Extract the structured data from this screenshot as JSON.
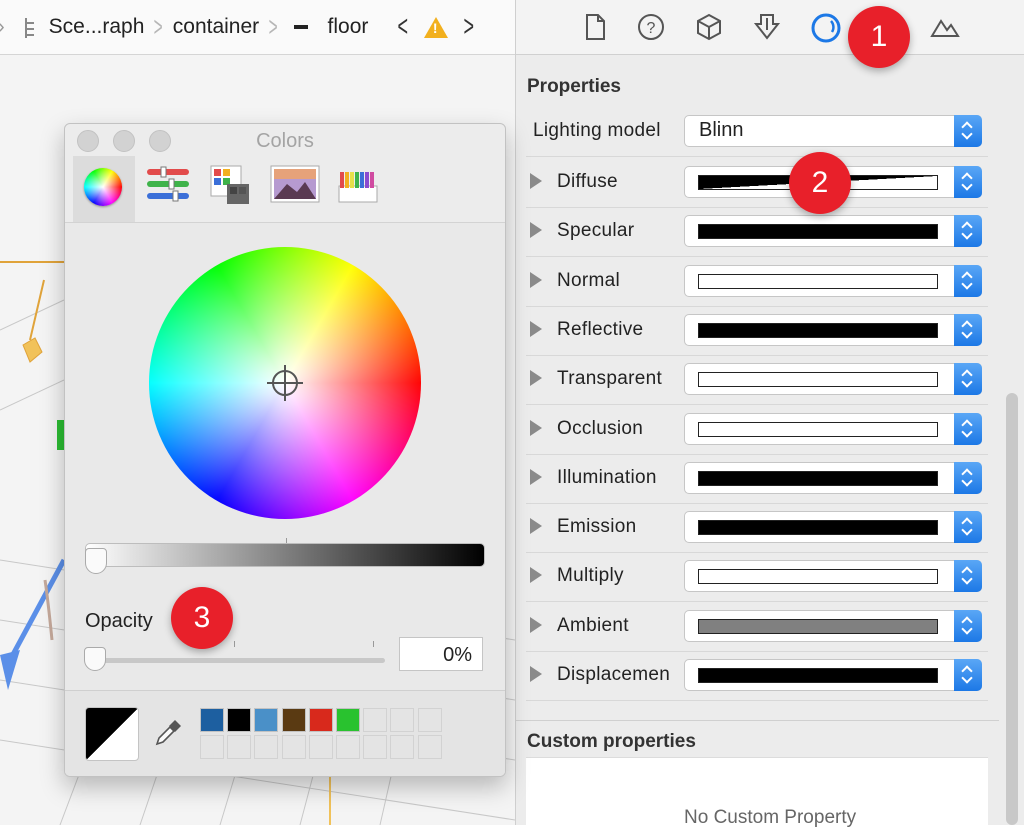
{
  "breadcrumb": {
    "items": [
      "Sce...raph",
      "container",
      "floor"
    ]
  },
  "inspector": {
    "tabs": [
      "file-inspector",
      "quick-help",
      "node-inspector",
      "attributes-inspector",
      "material-inspector",
      "scene-inspector"
    ],
    "properties_title": "Properties",
    "lighting_model_label": "Lighting model",
    "lighting_model_value": "Blinn",
    "properties": [
      {
        "label": "Diffuse",
        "swatch": "#000000",
        "white_swatch": false
      },
      {
        "label": "Specular",
        "swatch": "#000000",
        "white_swatch": false
      },
      {
        "label": "Normal",
        "swatch": "#ffffff",
        "white_swatch": true
      },
      {
        "label": "Reflective",
        "swatch": "#000000",
        "white_swatch": false
      },
      {
        "label": "Transparent",
        "swatch": "#ffffff",
        "white_swatch": true
      },
      {
        "label": "Occlusion",
        "swatch": "#ffffff",
        "white_swatch": true
      },
      {
        "label": "Illumination",
        "swatch": "#000000",
        "white_swatch": false
      },
      {
        "label": "Emission",
        "swatch": "#000000",
        "white_swatch": false
      },
      {
        "label": "Multiply",
        "swatch": "#ffffff",
        "white_swatch": true
      },
      {
        "label": "Ambient",
        "swatch": "#808080",
        "white_swatch": false
      },
      {
        "label": "Displacemen",
        "swatch": "#000000",
        "white_swatch": false
      }
    ],
    "custom_title": "Custom properties",
    "no_custom": "No Custom Property"
  },
  "colors_panel": {
    "title": "Colors",
    "modes": [
      "color-wheel",
      "color-sliders",
      "color-palettes",
      "image-palettes",
      "pencils"
    ],
    "opacity_label": "Opacity",
    "opacity_value": "0%",
    "opacity_fraction": 0,
    "brightness_fraction": 0,
    "swatches": [
      "#1d5fa0",
      "#000000",
      "#4a90c8",
      "#5a3a12",
      "#d8291c",
      "#29c22f"
    ]
  },
  "badges": [
    "1",
    "2",
    "3"
  ],
  "colors": {
    "accent_blue": "#1c78e6",
    "badge_red": "#e8202a"
  }
}
